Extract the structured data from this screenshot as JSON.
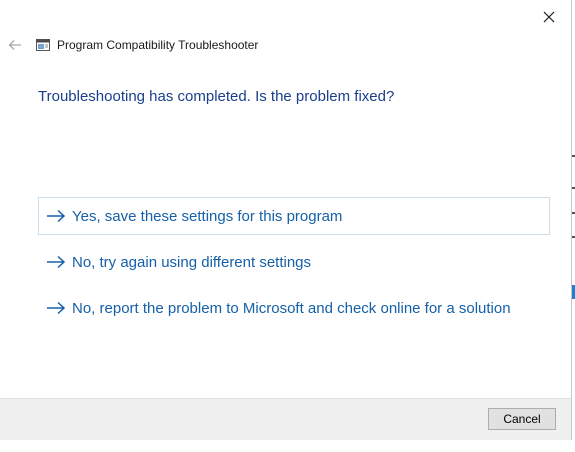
{
  "window": {
    "title": "Program Compatibility Troubleshooter"
  },
  "main": {
    "heading": "Troubleshooting has completed.  Is the problem fixed?",
    "options": [
      {
        "label": "Yes, save these settings for this program",
        "icon": "arrow-right-icon",
        "selected": true
      },
      {
        "label": "No, try again using different settings",
        "icon": "arrow-right-icon",
        "selected": false
      },
      {
        "label": "No, report the problem to Microsoft and check online for a solution",
        "icon": "arrow-right-icon",
        "selected": false
      }
    ]
  },
  "footer": {
    "cancel_label": "Cancel"
  },
  "colors": {
    "heading": "#1a3f8c",
    "link": "#1560a8",
    "footer_bg": "#f0f0f0"
  }
}
